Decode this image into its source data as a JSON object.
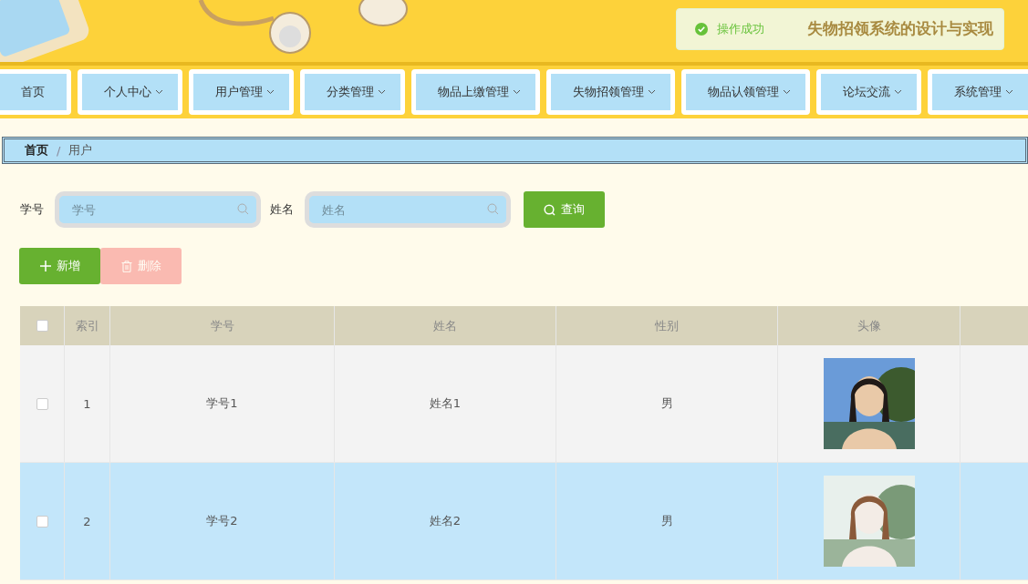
{
  "header": {
    "title": "失物招领系统的设计与实现"
  },
  "toast": {
    "kind": "success",
    "message": "操作成功"
  },
  "nav": [
    {
      "label": "首页",
      "has_menu": false
    },
    {
      "label": "个人中心",
      "has_menu": true
    },
    {
      "label": "用户管理",
      "has_menu": true
    },
    {
      "label": "分类管理",
      "has_menu": true
    },
    {
      "label": "物品上缴管理",
      "has_menu": true
    },
    {
      "label": "失物招领管理",
      "has_menu": true
    },
    {
      "label": "物品认领管理",
      "has_menu": true
    },
    {
      "label": "论坛交流",
      "has_menu": true
    },
    {
      "label": "系统管理",
      "has_menu": true
    }
  ],
  "breadcrumb_separator": "/",
  "breadcrumb": [
    {
      "label": "首页",
      "selected": false
    },
    {
      "label": "用户",
      "selected": true
    }
  ],
  "search": {
    "fields": [
      {
        "label": "学号",
        "placeholder": "学号"
      },
      {
        "label": "姓名",
        "placeholder": "姓名"
      }
    ],
    "button": "查询"
  },
  "actions": [
    {
      "label": "新增",
      "kind": "add",
      "disabled": false
    },
    {
      "label": "删除",
      "kind": "delete",
      "disabled": true
    }
  ],
  "table": {
    "all_checked": false,
    "columns": [
      "索引",
      "学号",
      "姓名",
      "性别",
      "头像"
    ],
    "rows": [
      {
        "checked": false,
        "highlighted": false,
        "cells": [
          "1",
          "学号1",
          "姓名1",
          "男"
        ],
        "avatar": {
          "kind": "picture"
        }
      },
      {
        "checked": false,
        "highlighted": true,
        "cells": [
          "2",
          "学号2",
          "姓名2",
          "男"
        ],
        "avatar": {
          "kind": "picture"
        }
      }
    ]
  }
}
